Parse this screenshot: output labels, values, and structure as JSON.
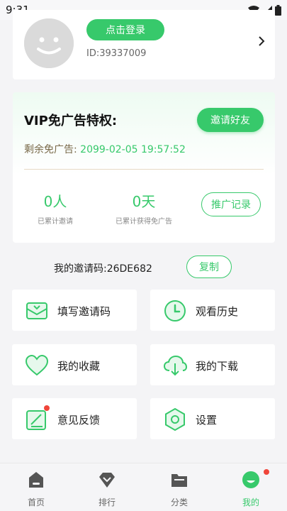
{
  "status_bar": {
    "time": "9:31"
  },
  "profile": {
    "login_label": "点击登录",
    "user_id": "ID:39337009"
  },
  "vip": {
    "title": "VIP免广告特权:",
    "invite_label": "邀请好友",
    "ad_free_label": "剩余免广告:",
    "ad_free_value": "2099-02-05 19:57:52",
    "invited_value": "0人",
    "invited_label": "已累计邀请",
    "days_value": "0天",
    "days_label": "已累计获得免广告",
    "record_label": "推广记录"
  },
  "invite_code": {
    "label": "我的邀请码:26DE682",
    "copy_label": "复制"
  },
  "tiles": [
    {
      "label": "填写邀请码",
      "icon": "mail-icon"
    },
    {
      "label": "观看历史",
      "icon": "clock-icon"
    },
    {
      "label": "我的收藏",
      "icon": "heart-icon"
    },
    {
      "label": "我的下载",
      "icon": "cloud-download-icon"
    },
    {
      "label": "意见反馈",
      "icon": "feedback-icon"
    },
    {
      "label": "设置",
      "icon": "settings-icon"
    }
  ],
  "nav": [
    {
      "label": "首页",
      "icon": "home-icon"
    },
    {
      "label": "排行",
      "icon": "ranking-icon"
    },
    {
      "label": "分类",
      "icon": "folder-icon"
    },
    {
      "label": "我的",
      "icon": "profile-icon",
      "active": true
    }
  ],
  "colors": {
    "accent": "#37c96b",
    "badge": "#f0453a"
  }
}
